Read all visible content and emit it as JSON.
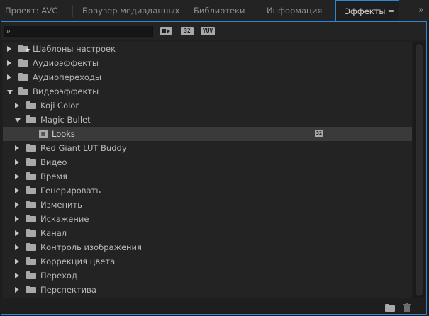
{
  "tabs": [
    {
      "label": "Проект: AVC",
      "active": false
    },
    {
      "label": "Браузер медиаданных",
      "active": false
    },
    {
      "label": "Библиотеки",
      "active": false
    },
    {
      "label": "Информация",
      "active": false
    },
    {
      "label": "Эффекты",
      "active": true
    }
  ],
  "tab_menu_glyph": "≡",
  "overflow_glyph": "»",
  "search": {
    "placeholder": "",
    "value": "",
    "icon": "search-icon"
  },
  "filter_badges": [
    "32",
    "YUV"
  ],
  "tree": [
    {
      "label": "Шаблоны настроек",
      "level": 0,
      "state": "collapsed",
      "icon": "preset-folder-icon"
    },
    {
      "label": "Аудиоэффекты",
      "level": 0,
      "state": "collapsed",
      "icon": "folder-icon"
    },
    {
      "label": "Аудиопереходы",
      "level": 0,
      "state": "collapsed",
      "icon": "folder-icon"
    },
    {
      "label": "Видеоэффекты",
      "level": 0,
      "state": "expanded",
      "icon": "folder-icon"
    },
    {
      "label": "Koji Color",
      "level": 1,
      "state": "collapsed",
      "icon": "folder-icon"
    },
    {
      "label": "Magic Bullet",
      "level": 1,
      "state": "expanded",
      "icon": "folder-icon"
    },
    {
      "label": "Looks",
      "level": 2,
      "state": "leaf",
      "icon": "effect-icon",
      "badge": "32",
      "selected": true
    },
    {
      "label": "Red Giant LUT Buddy",
      "level": 1,
      "state": "collapsed",
      "icon": "folder-icon"
    },
    {
      "label": "Видео",
      "level": 1,
      "state": "collapsed",
      "icon": "folder-icon"
    },
    {
      "label": "Время",
      "level": 1,
      "state": "collapsed",
      "icon": "folder-icon"
    },
    {
      "label": "Генерировать",
      "level": 1,
      "state": "collapsed",
      "icon": "folder-icon"
    },
    {
      "label": "Изменить",
      "level": 1,
      "state": "collapsed",
      "icon": "folder-icon"
    },
    {
      "label": "Искажение",
      "level": 1,
      "state": "collapsed",
      "icon": "folder-icon"
    },
    {
      "label": "Канал",
      "level": 1,
      "state": "collapsed",
      "icon": "folder-icon"
    },
    {
      "label": "Контроль изображения",
      "level": 1,
      "state": "collapsed",
      "icon": "folder-icon"
    },
    {
      "label": "Коррекция цвета",
      "level": 1,
      "state": "collapsed",
      "icon": "folder-icon"
    },
    {
      "label": "Переход",
      "level": 1,
      "state": "collapsed",
      "icon": "folder-icon"
    },
    {
      "label": "Перспектива",
      "level": 1,
      "state": "collapsed",
      "icon": "folder-icon"
    }
  ],
  "colors": {
    "accent": "#2c87d7",
    "background": "#1e1e1e",
    "list_bg": "#232323",
    "selected_row": "#3a3a3a"
  }
}
